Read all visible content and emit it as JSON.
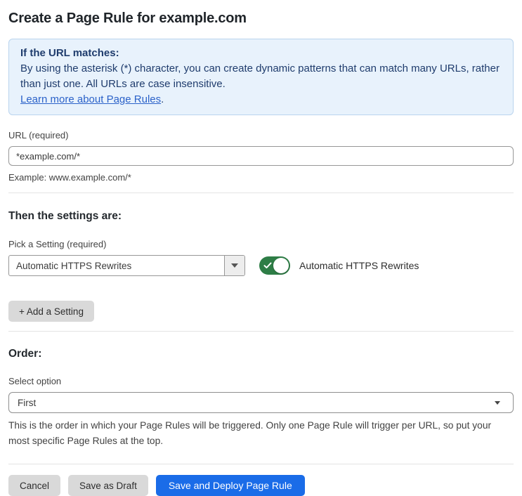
{
  "page": {
    "title": "Create a Page Rule for example.com"
  },
  "info_box": {
    "heading": "If the URL matches:",
    "body": "By using the asterisk (*) character, you can create dynamic patterns that can match many URLs, rather than just one. All URLs are case insensitive.",
    "link_label": "Learn more about Page Rules",
    "link_suffix": "."
  },
  "url_field": {
    "label": "URL (required)",
    "value": "*example.com/*",
    "helper": "Example: www.example.com/*"
  },
  "settings_section": {
    "heading": "Then the settings are:",
    "picker_label": "Pick a Setting (required)",
    "picker_value": "Automatic HTTPS Rewrites",
    "toggle_state": "on",
    "toggle_label": "Automatic HTTPS Rewrites",
    "add_setting_label": "+ Add a Setting"
  },
  "order_section": {
    "heading": "Order:",
    "select_label": "Select option",
    "select_value": "First",
    "description": "This is the order in which your Page Rules will be triggered. Only one Page Rule will trigger per URL, so put your most specific Page Rules at the top."
  },
  "footer": {
    "cancel_label": "Cancel",
    "save_draft_label": "Save as Draft",
    "save_deploy_label": "Save and Deploy Page Rule"
  },
  "colors": {
    "info_bg": "#e8f2fc",
    "info_border": "#bad4ee",
    "info_text": "#1f3c6d",
    "link_blue": "#2b62c9",
    "toggle_on_green": "#2e7d46",
    "primary_button_blue": "#1a6ce8",
    "secondary_button_gray": "#d9d9d9"
  }
}
